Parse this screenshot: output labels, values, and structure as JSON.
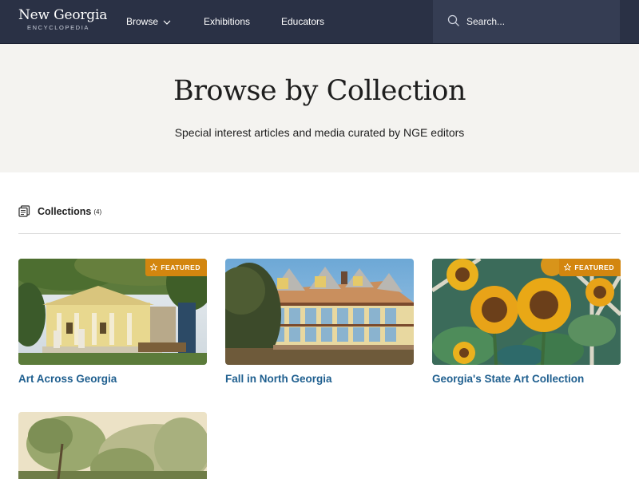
{
  "header": {
    "logo_title": "New Georgia",
    "logo_subtitle": "ENCYCLOPEDIA",
    "nav": [
      {
        "label": "Browse",
        "icon": "chevron-down-icon"
      },
      {
        "label": "Exhibitions"
      },
      {
        "label": "Educators"
      }
    ],
    "search": {
      "placeholder": "Search...",
      "value": "",
      "icon": "search-icon"
    }
  },
  "hero": {
    "title": "Browse by Collection",
    "subtitle": "Special interest articles and media curated by NGE editors"
  },
  "collections": {
    "label": "Collections",
    "count": "(4)",
    "icon": "collection-icon"
  },
  "cards": [
    {
      "title": "Art Across Georgia",
      "badge": "FEATURED",
      "featured": true
    },
    {
      "title": "Fall in North Georgia",
      "badge": "",
      "featured": false
    },
    {
      "title": "Georgia's State Art Collection",
      "badge": "FEATURED",
      "featured": true
    },
    {
      "title": "",
      "badge": "",
      "featured": false
    }
  ],
  "colors": {
    "header_bg": "#2a3145",
    "search_bg": "#353d53",
    "hero_bg": "#f4f3f0",
    "link": "#1f5f8f",
    "badge": "#d3860f"
  }
}
